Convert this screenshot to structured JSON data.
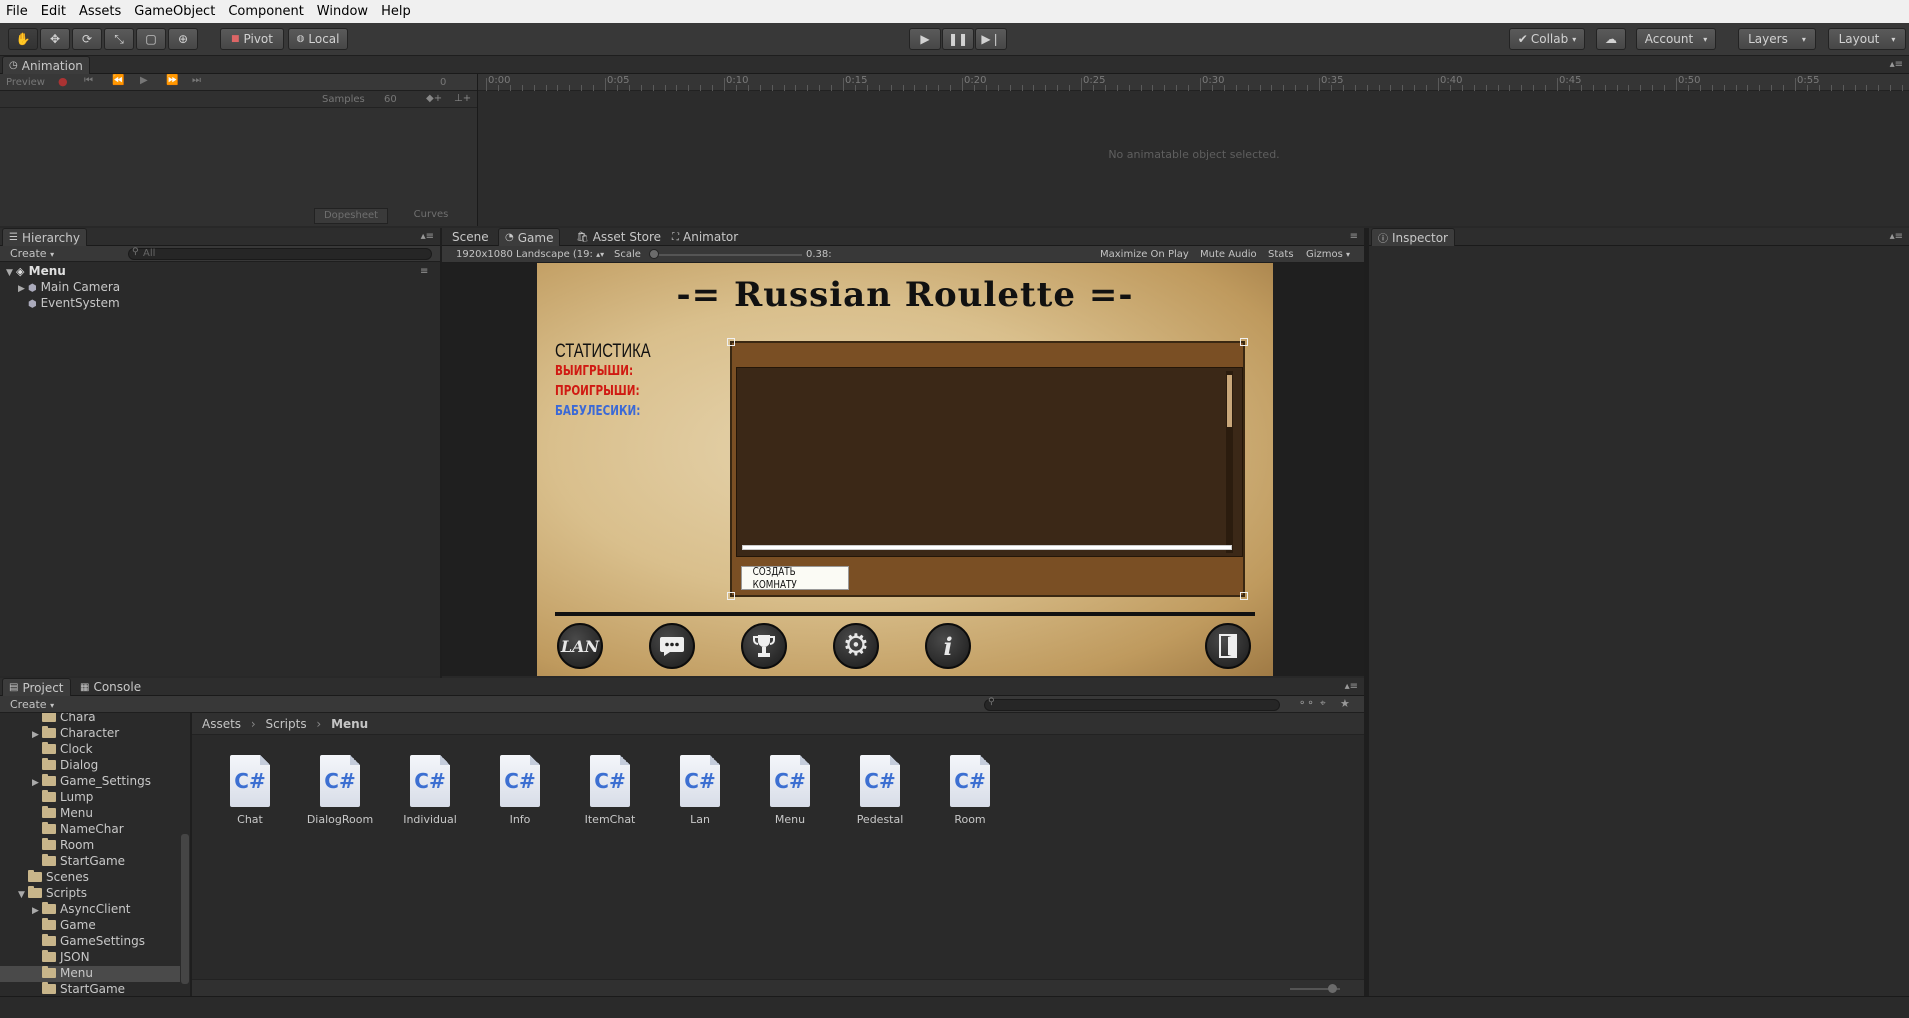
{
  "menu": [
    "File",
    "Edit",
    "Assets",
    "GameObject",
    "Component",
    "Window",
    "Help"
  ],
  "toolbar": {
    "pivot": "Pivot",
    "local": "Local",
    "collab": "Collab",
    "account": "Account",
    "layers": "Layers",
    "layout": "Layout"
  },
  "animation": {
    "tab": "Animation",
    "preview": "Preview",
    "samples_label": "Samples",
    "samples_value": "60",
    "frame": "0",
    "empty": "No animatable object selected.",
    "dopesheet": "Dopesheet",
    "curves": "Curves",
    "ruler": [
      "0:00",
      "0:05",
      "0:10",
      "0:15",
      "0:20",
      "0:25",
      "0:30",
      "0:35",
      "0:40",
      "0:45",
      "0:50",
      "0:55"
    ]
  },
  "hierarchy": {
    "tab": "Hierarchy",
    "create": "Create",
    "search_placeholder": "All",
    "scene": "Menu",
    "items": [
      "Main Camera",
      "EventSystem"
    ]
  },
  "center": {
    "tabs": [
      "Scene",
      "Game",
      "Asset Store",
      "Animator"
    ],
    "resolution": "1920x1080 Landscape (19:",
    "scale_label": "Scale",
    "scale_value": "0.38:",
    "options": [
      "Maximize On Play",
      "Mute Audio",
      "Stats",
      "Gizmos"
    ]
  },
  "game": {
    "title": "-= Russian Roulette =-",
    "stats_heading": "СТАТИСТИКА",
    "wins": "ВЫИГРЫШИ:",
    "losses": "ПРОИГРЫШИ:",
    "money": "БАБУЛЕСИКИ:",
    "create_room": "СОЗДАТЬ КОМНАТУ",
    "lan": "LAN",
    "info": "i"
  },
  "inspector": {
    "tab": "Inspector"
  },
  "project": {
    "tabs": [
      "Project",
      "Console"
    ],
    "create": "Create",
    "breadcrumb": [
      "Assets",
      "Scripts",
      "Menu"
    ],
    "tree": [
      {
        "label": "Chara",
        "indent": 2,
        "arrow": false
      },
      {
        "label": "Character",
        "indent": 2,
        "arrow": true
      },
      {
        "label": "Clock",
        "indent": 2,
        "arrow": false
      },
      {
        "label": "Dialog",
        "indent": 2,
        "arrow": false
      },
      {
        "label": "Game_Settings",
        "indent": 2,
        "arrow": true
      },
      {
        "label": "Lump",
        "indent": 2,
        "arrow": false
      },
      {
        "label": "Menu",
        "indent": 2,
        "arrow": false
      },
      {
        "label": "NameChar",
        "indent": 2,
        "arrow": false
      },
      {
        "label": "Room",
        "indent": 2,
        "arrow": false
      },
      {
        "label": "StartGame",
        "indent": 2,
        "arrow": false
      },
      {
        "label": "Scenes",
        "indent": 1,
        "arrow": false
      },
      {
        "label": "Scripts",
        "indent": 1,
        "arrow": "open"
      },
      {
        "label": "AsyncClient",
        "indent": 2,
        "arrow": true
      },
      {
        "label": "Game",
        "indent": 2,
        "arrow": false
      },
      {
        "label": "GameSettings",
        "indent": 2,
        "arrow": false
      },
      {
        "label": "JSON",
        "indent": 2,
        "arrow": false
      },
      {
        "label": "Menu",
        "indent": 2,
        "arrow": false,
        "selected": true
      },
      {
        "label": "StartGame",
        "indent": 2,
        "arrow": false
      }
    ],
    "files": [
      "Chat",
      "DialogRoom",
      "Individual",
      "Info",
      "ItemChat",
      "Lan",
      "Menu",
      "Pedestal",
      "Room"
    ],
    "cs": "C#"
  }
}
